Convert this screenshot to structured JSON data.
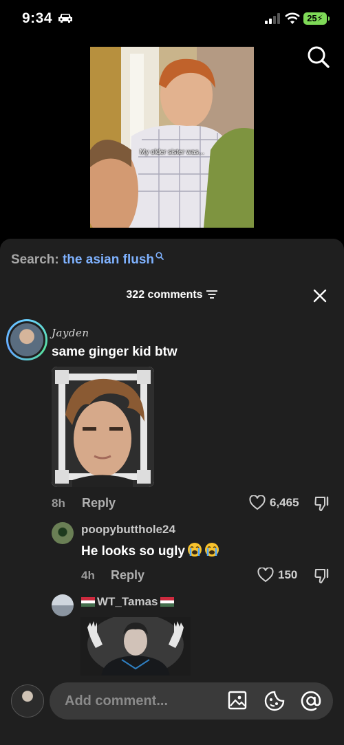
{
  "status_bar": {
    "time": "9:34",
    "battery": "25"
  },
  "video": {
    "caption": "My older sister was..."
  },
  "search": {
    "label": "Search:",
    "query": "the asian flush"
  },
  "comments_header": {
    "count_label": "322 comments"
  },
  "comments": [
    {
      "username": "Jayden",
      "text": "same ginger kid btw",
      "time": "8h",
      "reply_label": "Reply",
      "likes": "6,465"
    }
  ],
  "replies": [
    {
      "username": "poopybutthole24",
      "text": "He looks so ugly",
      "time": "4h",
      "reply_label": "Reply",
      "likes": "150"
    },
    {
      "username": "WT_Tamas"
    }
  ],
  "composer": {
    "placeholder": "Add comment..."
  },
  "colors": {
    "accent_link": "#7fb2ff",
    "panel_bg": "#1f1f1f",
    "battery": "#7ed957"
  },
  "icons": [
    "car-icon",
    "signal-icon",
    "wifi-icon",
    "search-icon",
    "sort-icon",
    "close-icon",
    "heart-icon",
    "dislike-icon",
    "image-icon",
    "sticker-icon",
    "mention-icon"
  ]
}
